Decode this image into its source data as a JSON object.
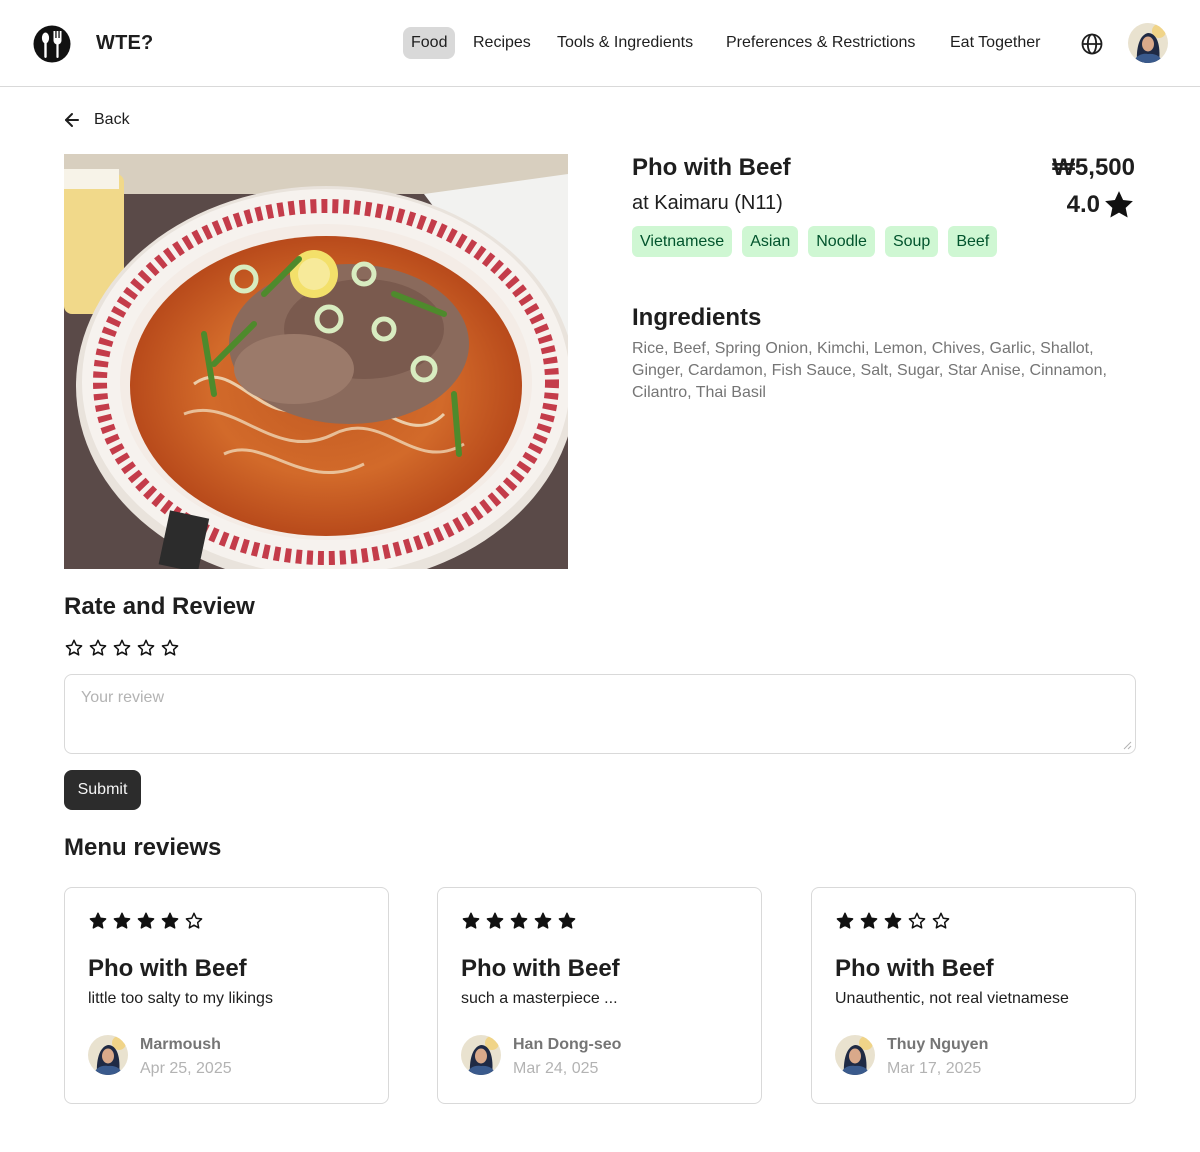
{
  "header": {
    "brand": "WTE?",
    "nav": [
      {
        "label": "Food",
        "active": true
      },
      {
        "label": "Recipes",
        "active": false
      },
      {
        "label": "Tools & Ingredients",
        "active": false
      },
      {
        "label": "Preferences & Restrictions",
        "active": false
      },
      {
        "label": "Eat Together",
        "active": false
      }
    ],
    "icons": {
      "logo": "fork-spoon-logo-icon",
      "language": "globe-icon",
      "profile": "avatar"
    }
  },
  "back_label": "Back",
  "dish": {
    "name": "Pho with Beef",
    "place": "at Kaimaru (N11)",
    "price": "₩5,500",
    "rating": "4.0",
    "tags": [
      "Vietnamese",
      "Asian",
      "Noodle",
      "Soup",
      "Beef"
    ],
    "photo": "pho-bowl-photo"
  },
  "ingredients": {
    "title": "Ingredients",
    "text": "Rice, Beef, Spring Onion, Kimchi, Lemon, Chives, Garlic, Shallot, Ginger, Cardamon, Fish Sauce, Salt, Sugar, Star Anise, Cinnamon, Cilantro, Thai Basil"
  },
  "rate_review": {
    "title": "Rate and Review",
    "star_count": 5,
    "placeholder": "Your review",
    "value": "",
    "submit_label": "Submit"
  },
  "menu_reviews": {
    "title": "Menu reviews",
    "items": [
      {
        "rating": 4,
        "dish": "Pho with Beef",
        "text": "little too salty to my likings",
        "author": "Marmoush",
        "date": "Apr 25, 2025"
      },
      {
        "rating": 5,
        "dish": "Pho with Beef",
        "text": "such a masterpiece ...",
        "author": "Han Dong-seo",
        "date": "Mar 24, 025"
      },
      {
        "rating": 3,
        "dish": "Pho with Beef",
        "text": "Unauthentic, not real vietnamese",
        "author": "Thuy Nguyen",
        "date": "Mar 17, 2025"
      }
    ]
  },
  "colors": {
    "tag_bg": "#cff7d3",
    "tag_text": "#02542d",
    "nav_active_bg": "#d9d9d9",
    "button_bg": "#2c2c2c",
    "muted_text": "#757575",
    "placeholder_text": "#b3b3b3"
  }
}
